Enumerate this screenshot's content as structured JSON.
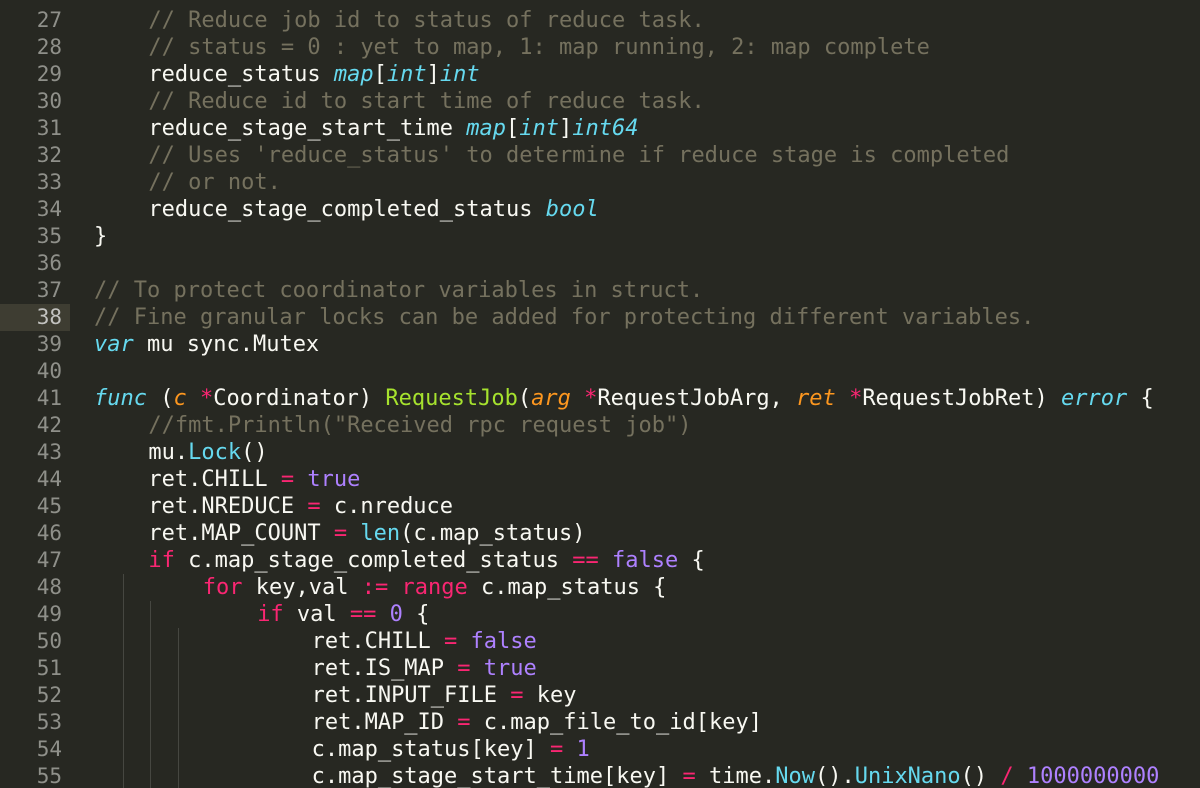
{
  "editor": {
    "active_line": 38,
    "colors": {
      "background": "#272822",
      "gutter_text": "#8f908a",
      "active_gutter": "#3e3d32",
      "plain": "#f8f8f2",
      "comment": "#75715e",
      "keyword": "#f92672",
      "type": "#66d9ef",
      "function_name": "#a6e22e",
      "parameter": "#fd971f",
      "number_constant": "#ae81ff"
    },
    "lines": [
      {
        "n": "27",
        "indent": 2,
        "tokens": [
          {
            "t": "// Reduce job id to status of reduce task.",
            "k": "c"
          }
        ]
      },
      {
        "n": "28",
        "indent": 2,
        "tokens": [
          {
            "t": "// status = 0 : yet to map, 1: map running, 2: map complete",
            "k": "c"
          }
        ]
      },
      {
        "n": "29",
        "indent": 2,
        "tokens": [
          {
            "t": "reduce_status ",
            "k": "p"
          },
          {
            "t": "map",
            "k": "t"
          },
          {
            "t": "[",
            "k": "p"
          },
          {
            "t": "int",
            "k": "t"
          },
          {
            "t": "]",
            "k": "p"
          },
          {
            "t": "int",
            "k": "t"
          }
        ]
      },
      {
        "n": "30",
        "indent": 2,
        "tokens": [
          {
            "t": "// Reduce id to start time of reduce task.",
            "k": "c"
          }
        ]
      },
      {
        "n": "31",
        "indent": 2,
        "tokens": [
          {
            "t": "reduce_stage_start_time ",
            "k": "p"
          },
          {
            "t": "map",
            "k": "t"
          },
          {
            "t": "[",
            "k": "p"
          },
          {
            "t": "int",
            "k": "t"
          },
          {
            "t": "]",
            "k": "p"
          },
          {
            "t": "int64",
            "k": "t"
          }
        ]
      },
      {
        "n": "32",
        "indent": 2,
        "tokens": [
          {
            "t": "// Uses 'reduce_status' to determine if reduce stage is completed",
            "k": "c"
          }
        ]
      },
      {
        "n": "33",
        "indent": 2,
        "tokens": [
          {
            "t": "// or not.",
            "k": "c"
          }
        ]
      },
      {
        "n": "34",
        "indent": 2,
        "tokens": [
          {
            "t": "reduce_stage_completed_status ",
            "k": "p"
          },
          {
            "t": "bool",
            "k": "t"
          }
        ]
      },
      {
        "n": "35",
        "indent": 0,
        "tokens": [
          {
            "t": "}",
            "k": "p"
          }
        ]
      },
      {
        "n": "36",
        "indent": 0,
        "tokens": []
      },
      {
        "n": "37",
        "indent": 0,
        "tokens": [
          {
            "t": "// To protect coordinator variables in struct.",
            "k": "c"
          }
        ]
      },
      {
        "n": "38",
        "indent": 0,
        "tokens": [
          {
            "t": "// Fine granular locks can be added for protecting different variables.",
            "k": "c"
          }
        ]
      },
      {
        "n": "39",
        "indent": 0,
        "tokens": [
          {
            "t": "var",
            "k": "t"
          },
          {
            "t": " mu sync.Mutex",
            "k": "p"
          }
        ]
      },
      {
        "n": "40",
        "indent": 0,
        "tokens": []
      },
      {
        "n": "41",
        "indent": 0,
        "tokens": [
          {
            "t": "func",
            "k": "t"
          },
          {
            "t": " (",
            "k": "p"
          },
          {
            "t": "c",
            "k": "a"
          },
          {
            "t": " ",
            "k": "p"
          },
          {
            "t": "*",
            "k": "o"
          },
          {
            "t": "Coordinator) ",
            "k": "p"
          },
          {
            "t": "RequestJob",
            "k": "f"
          },
          {
            "t": "(",
            "k": "p"
          },
          {
            "t": "arg",
            "k": "a"
          },
          {
            "t": " ",
            "k": "p"
          },
          {
            "t": "*",
            "k": "o"
          },
          {
            "t": "RequestJobArg, ",
            "k": "p"
          },
          {
            "t": "ret",
            "k": "a"
          },
          {
            "t": " ",
            "k": "p"
          },
          {
            "t": "*",
            "k": "o"
          },
          {
            "t": "RequestJobRet) ",
            "k": "p"
          },
          {
            "t": "error",
            "k": "t"
          },
          {
            "t": " {",
            "k": "p"
          }
        ]
      },
      {
        "n": "42",
        "indent": 2,
        "tokens": [
          {
            "t": "//fmt.Println(\"Received rpc request job\")",
            "k": "c"
          }
        ]
      },
      {
        "n": "43",
        "indent": 2,
        "tokens": [
          {
            "t": "mu.",
            "k": "p"
          },
          {
            "t": "Lock",
            "k": "b"
          },
          {
            "t": "()",
            "k": "p"
          }
        ]
      },
      {
        "n": "44",
        "indent": 2,
        "tokens": [
          {
            "t": "ret.CHILL ",
            "k": "p"
          },
          {
            "t": "=",
            "k": "o"
          },
          {
            "t": " ",
            "k": "p"
          },
          {
            "t": "true",
            "k": "n"
          }
        ]
      },
      {
        "n": "45",
        "indent": 2,
        "tokens": [
          {
            "t": "ret.NREDUCE ",
            "k": "p"
          },
          {
            "t": "=",
            "k": "o"
          },
          {
            "t": " c.nreduce",
            "k": "p"
          }
        ]
      },
      {
        "n": "46",
        "indent": 2,
        "tokens": [
          {
            "t": "ret.MAP_COUNT ",
            "k": "p"
          },
          {
            "t": "=",
            "k": "o"
          },
          {
            "t": " ",
            "k": "p"
          },
          {
            "t": "len",
            "k": "b"
          },
          {
            "t": "(c.map_status)",
            "k": "p"
          }
        ]
      },
      {
        "n": "47",
        "indent": 2,
        "tokens": [
          {
            "t": "if",
            "k": "k"
          },
          {
            "t": " c.map_stage_completed_status ",
            "k": "p"
          },
          {
            "t": "==",
            "k": "o"
          },
          {
            "t": " ",
            "k": "p"
          },
          {
            "t": "false",
            "k": "n"
          },
          {
            "t": " {",
            "k": "p"
          }
        ]
      },
      {
        "n": "48",
        "indent": 4,
        "tokens": [
          {
            "t": "for",
            "k": "k"
          },
          {
            "t": " key,val ",
            "k": "p"
          },
          {
            "t": ":=",
            "k": "o"
          },
          {
            "t": " ",
            "k": "p"
          },
          {
            "t": "range",
            "k": "k"
          },
          {
            "t": " c.map_status {",
            "k": "p"
          }
        ]
      },
      {
        "n": "49",
        "indent": 6,
        "tokens": [
          {
            "t": "if",
            "k": "k"
          },
          {
            "t": " val ",
            "k": "p"
          },
          {
            "t": "==",
            "k": "o"
          },
          {
            "t": " ",
            "k": "p"
          },
          {
            "t": "0",
            "k": "n"
          },
          {
            "t": " {",
            "k": "p"
          }
        ]
      },
      {
        "n": "50",
        "indent": 8,
        "tokens": [
          {
            "t": "ret.CHILL ",
            "k": "p"
          },
          {
            "t": "=",
            "k": "o"
          },
          {
            "t": " ",
            "k": "p"
          },
          {
            "t": "false",
            "k": "n"
          }
        ]
      },
      {
        "n": "51",
        "indent": 8,
        "tokens": [
          {
            "t": "ret.IS_MAP ",
            "k": "p"
          },
          {
            "t": "=",
            "k": "o"
          },
          {
            "t": " ",
            "k": "p"
          },
          {
            "t": "true",
            "k": "n"
          }
        ]
      },
      {
        "n": "52",
        "indent": 8,
        "tokens": [
          {
            "t": "ret.INPUT_FILE ",
            "k": "p"
          },
          {
            "t": "=",
            "k": "o"
          },
          {
            "t": " key",
            "k": "p"
          }
        ]
      },
      {
        "n": "53",
        "indent": 8,
        "tokens": [
          {
            "t": "ret.MAP_ID ",
            "k": "p"
          },
          {
            "t": "=",
            "k": "o"
          },
          {
            "t": " c.map_file_to_id[key]",
            "k": "p"
          }
        ]
      },
      {
        "n": "54",
        "indent": 8,
        "tokens": [
          {
            "t": "c.map_status[key] ",
            "k": "p"
          },
          {
            "t": "=",
            "k": "o"
          },
          {
            "t": " ",
            "k": "p"
          },
          {
            "t": "1",
            "k": "n"
          }
        ]
      },
      {
        "n": "55",
        "indent": 8,
        "tokens": [
          {
            "t": "c.map_stage_start_time[key] ",
            "k": "p"
          },
          {
            "t": "=",
            "k": "o"
          },
          {
            "t": " time.",
            "k": "p"
          },
          {
            "t": "Now",
            "k": "b"
          },
          {
            "t": "().",
            "k": "p"
          },
          {
            "t": "UnixNano",
            "k": "b"
          },
          {
            "t": "() ",
            "k": "p"
          },
          {
            "t": "/",
            "k": "o"
          },
          {
            "t": " ",
            "k": "p"
          },
          {
            "t": "1000000000",
            "k": "n"
          }
        ]
      }
    ]
  }
}
